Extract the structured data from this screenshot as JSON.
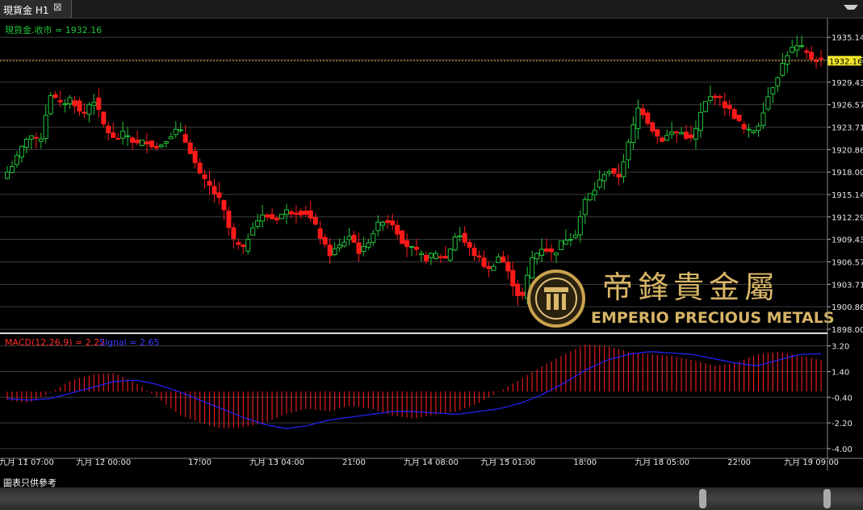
{
  "tab": {
    "label": "現貨金 H1",
    "close_icon": "close-icon"
  },
  "footer_note": "圖表只供參考",
  "logo": {
    "chinese": "帝鋒貴金屬",
    "english": "EMPERIO PRECIOUS METALS"
  },
  "colors": {
    "up": "#21c43a",
    "down": "#ff1a1a",
    "signal": "#2222ee",
    "macd_bar": "#e21b1b",
    "price_line": "#e8a33a",
    "price_tag": "#f3e82b"
  },
  "chart_data": [
    {
      "type": "candlestick",
      "title": "現貨金.收市 = 1932.16",
      "last_price": "1932.16",
      "ylim": [
        1898.0,
        1936.5
      ],
      "y_ticks": [
        "1935.14",
        "1932.29",
        "1929.43",
        "1926.57",
        "1923.71",
        "1920.86",
        "1918.00",
        "1915.14",
        "1912.29",
        "1909.43",
        "1906.57",
        "1903.71",
        "1900.86",
        "1898.00"
      ],
      "x_ticks": [
        "九月 11 07:00",
        "九月 12 00:00",
        "17:00",
        "九月 13 04:00",
        "21:00",
        "九月 14 08:00",
        "九月 15 01:00",
        "18:00",
        "九月 18 05:00",
        "22:00",
        "九月 19 09:00"
      ],
      "x_tick_index": [
        4,
        20,
        40,
        56,
        72,
        88,
        104,
        120,
        136,
        152,
        167
      ],
      "close_path": [
        1918.0,
        1920.0,
        1923.0,
        1921.5,
        1928.0,
        1926.5,
        1927.5,
        1925.0,
        1927.5,
        1924.0,
        1922.0,
        1923.0,
        1921.5,
        1922.0,
        1921.0,
        1922.5,
        1923.5,
        1921.0,
        1917.5,
        1916.0,
        1914.0,
        1909.5,
        1908.0,
        1911.5,
        1912.5,
        1912.0,
        1913.0,
        1913.0,
        1912.8,
        1910.5,
        1907.5,
        1908.5,
        1910.0,
        1907.5,
        1910.0,
        1912.0,
        1911.5,
        1909.0,
        1908.0,
        1907.0,
        1907.5,
        1907.0,
        1910.5,
        1908.5,
        1907.0,
        1905.5,
        1907.5,
        1904.5,
        1901.5,
        1907.0,
        1908.5,
        1907.5,
        1909.5,
        1910.0,
        1914.5,
        1916.0,
        1918.5,
        1917.0,
        1921.5,
        1926.5,
        1924.0,
        1922.0,
        1923.0,
        1923.0,
        1922.0,
        1926.5,
        1928.0,
        1926.5,
        1925.0,
        1923.0,
        1923.5,
        1927.5,
        1930.5,
        1933.5,
        1934.0,
        1932.5,
        1932.2
      ]
    },
    {
      "type": "macd",
      "title": "MACD(12,26,9) = 2.22",
      "signal_title": "Signal = 2.65",
      "ylim": [
        -4.4,
        3.8
      ],
      "y_ticks": [
        "3.20",
        "1.40",
        "-0.40",
        "-2.20",
        "-4.00"
      ],
      "macd_path": [
        -0.6,
        -0.8,
        -0.1,
        0.8,
        1.2,
        1.3,
        0.6,
        -0.4,
        -1.6,
        -2.2,
        -2.6,
        -2.5,
        -2.2,
        -1.6,
        -1.2,
        -1.4,
        -1.0,
        -1.2,
        -1.7,
        -1.9,
        -1.6,
        -1.4,
        -0.8,
        0.0,
        0.9,
        1.8,
        2.6,
        3.3,
        3.2,
        2.8,
        2.6,
        2.5,
        2.2,
        1.8,
        2.0,
        2.6,
        2.8,
        2.5,
        2.22
      ],
      "signal_path": [
        -0.5,
        -0.6,
        -0.5,
        -0.1,
        0.3,
        0.7,
        0.8,
        0.5,
        0.0,
        -0.6,
        -1.2,
        -1.8,
        -2.3,
        -2.6,
        -2.4,
        -2.0,
        -1.8,
        -1.6,
        -1.4,
        -1.4,
        -1.5,
        -1.6,
        -1.4,
        -1.2,
        -0.8,
        -0.2,
        0.6,
        1.5,
        2.2,
        2.6,
        2.8,
        2.7,
        2.6,
        2.3,
        2.0,
        1.8,
        2.2,
        2.6,
        2.65
      ]
    }
  ]
}
